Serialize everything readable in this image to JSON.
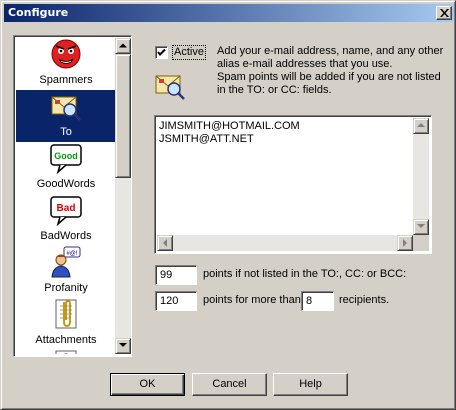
{
  "window": {
    "title": "Configure"
  },
  "sidebar": {
    "items": [
      {
        "label": "Spammers",
        "icon": "angry-face-icon",
        "selected": false
      },
      {
        "label": "To",
        "icon": "envelope-magnifier-icon",
        "selected": true
      },
      {
        "label": "GoodWords",
        "icon": "good-speech-bubble-icon",
        "badge": "Good",
        "selected": false
      },
      {
        "label": "BadWords",
        "icon": "bad-speech-bubble-icon",
        "badge": "Bad",
        "selected": false
      },
      {
        "label": "Profanity",
        "icon": "person-speaking-icon",
        "selected": false
      },
      {
        "label": "Attachments",
        "icon": "paperclip-document-icon",
        "selected": false
      }
    ]
  },
  "to_panel": {
    "active_label": "Active",
    "active_checked": true,
    "description_lines": [
      "Add your e-mail address, name, and any other",
      "alias e-mail addresses that you use.",
      "Spam points will be added if you are not listed",
      "in the TO: or CC: fields."
    ],
    "emails": [
      "JIMSMITH@HOTMAIL.COM",
      "JSMITH@ATT.NET"
    ],
    "not_listed_points": "99",
    "not_listed_label": "points if not listed in the TO:, CC: or BCC:",
    "many_recipients_points": "120",
    "many_recipients_label": "points for more than",
    "recipient_threshold": "8",
    "recipients_label": "recipients."
  },
  "buttons": {
    "ok": "OK",
    "cancel": "Cancel",
    "help": "Help"
  },
  "colors": {
    "titlebar_start": "#0a246a",
    "titlebar_end": "#a6caf0",
    "selection": "#0a246a",
    "face": "#d4d0c8"
  }
}
